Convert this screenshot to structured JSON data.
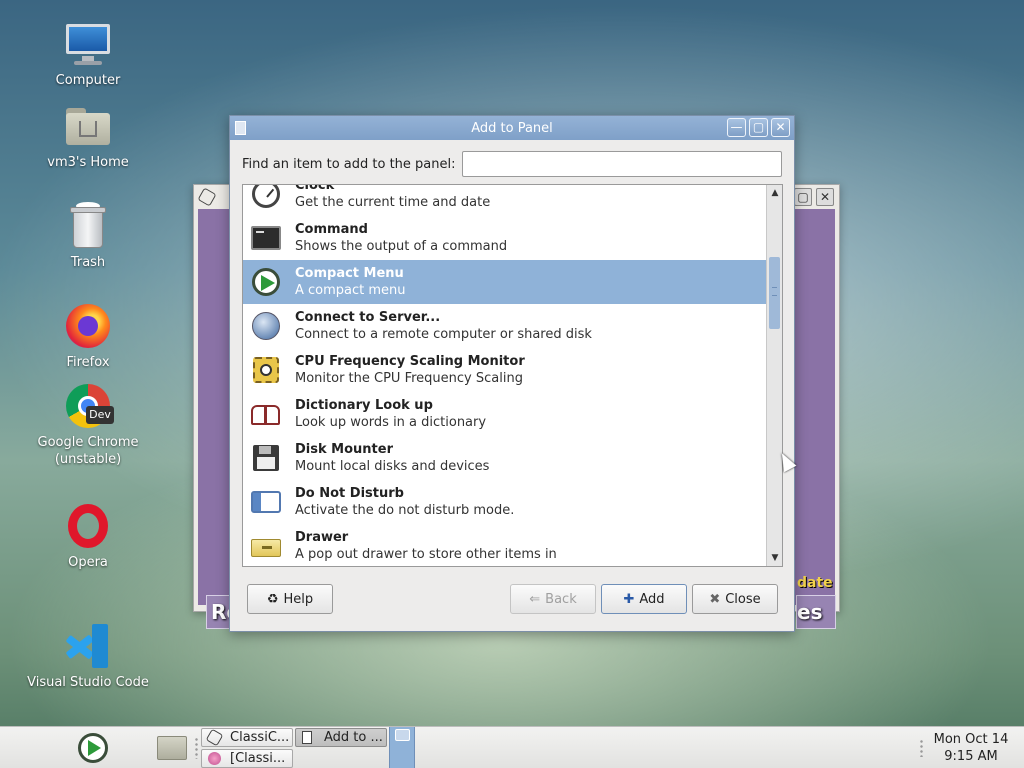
{
  "desktop": {
    "icons": [
      {
        "label": "Computer",
        "icon": "computer-icon"
      },
      {
        "label": "vm3's Home",
        "icon": "home-folder-icon"
      },
      {
        "label": "Trash",
        "icon": "trash-icon"
      },
      {
        "label": "Firefox",
        "icon": "firefox-icon"
      },
      {
        "label": "Google Chrome\n(unstable)",
        "label_line1": "Google Chrome",
        "label_line2": "(unstable)",
        "icon": "chrome-dev-icon"
      },
      {
        "label": "Opera",
        "icon": "opera-icon"
      },
      {
        "label": "Visual Studio Code",
        "icon": "vscode-icon"
      }
    ]
  },
  "background_window": {
    "fragments": {
      "date": "date",
      "left": "Re",
      "right": "es"
    }
  },
  "dialog": {
    "title": "Add to Panel",
    "find_label": "Find an item to add to the panel:",
    "find_value": "",
    "items": [
      {
        "name": "Clock",
        "desc": "Get the current time and date",
        "icon": "clock-icon",
        "selected": false
      },
      {
        "name": "Command",
        "desc": "Shows the output of a command",
        "icon": "terminal-icon",
        "selected": false
      },
      {
        "name": "Compact Menu",
        "desc": "A compact menu",
        "icon": "compact-menu-icon",
        "selected": true
      },
      {
        "name": "Connect to Server...",
        "desc": "Connect to a remote computer or shared disk",
        "icon": "globe-icon",
        "selected": false
      },
      {
        "name": "CPU Frequency Scaling Monitor",
        "desc": "Monitor the CPU Frequency Scaling",
        "icon": "cpu-icon",
        "selected": false
      },
      {
        "name": "Dictionary Look up",
        "desc": "Look up words in a dictionary",
        "icon": "book-icon",
        "selected": false
      },
      {
        "name": "Disk Mounter",
        "desc": "Mount local disks and devices",
        "icon": "floppy-icon",
        "selected": false
      },
      {
        "name": "Do Not Disturb",
        "desc": "Activate the do not disturb mode.",
        "icon": "do-not-disturb-icon",
        "selected": false
      },
      {
        "name": "Drawer",
        "desc": "A pop out drawer to store other items in",
        "icon": "drawer-icon",
        "selected": false
      }
    ],
    "buttons": {
      "help": "Help",
      "back": "Back",
      "add": "Add",
      "close": "Close"
    }
  },
  "taskbar": {
    "tasks": [
      {
        "label": "ClassiC...",
        "icon": "hexagon-icon",
        "active": false
      },
      {
        "label": "Add to ...",
        "icon": "panel-icon",
        "active": true
      },
      {
        "label": "[Classi...",
        "icon": "sprite-icon",
        "active": false
      }
    ],
    "clock_date": "Mon Oct 14",
    "clock_time": "9:15 AM"
  }
}
